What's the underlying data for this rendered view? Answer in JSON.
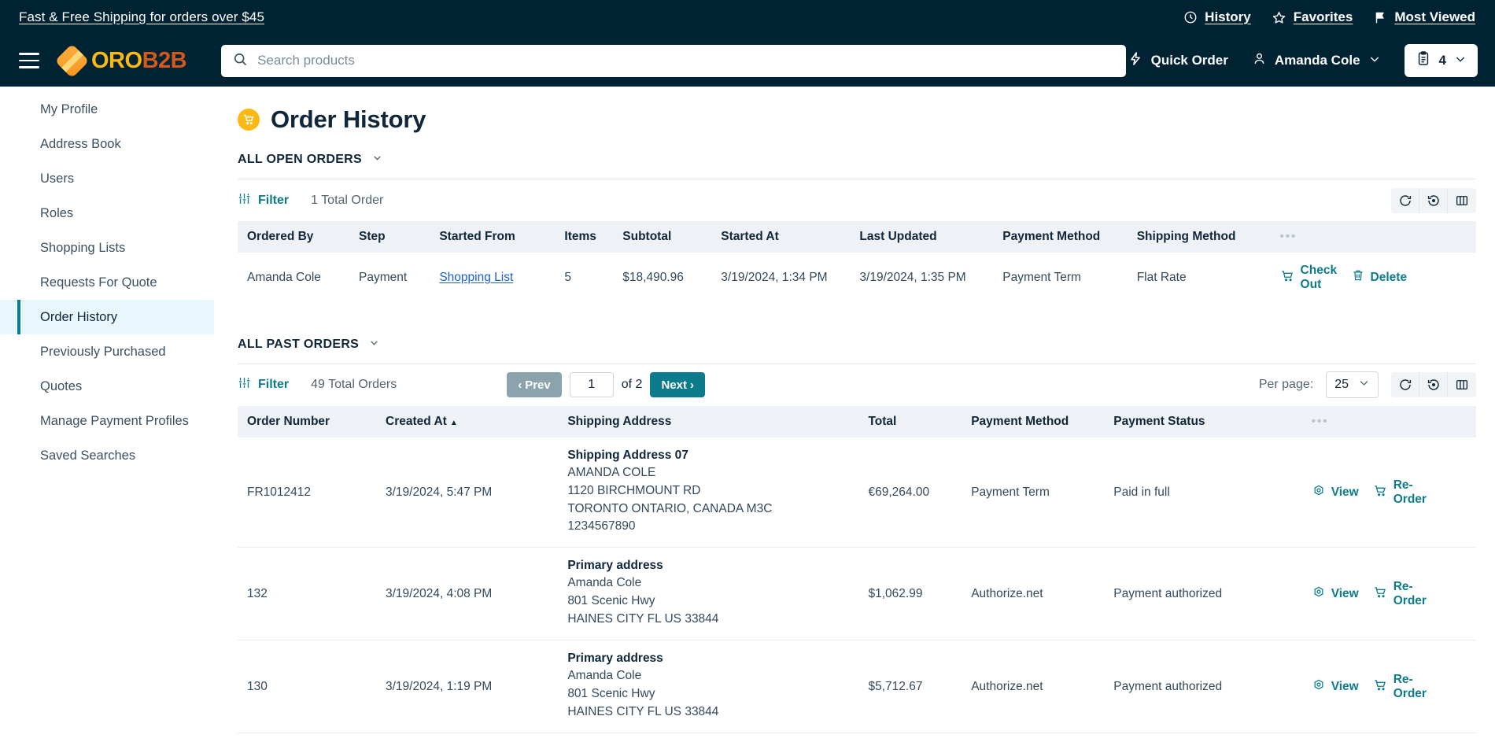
{
  "topbar": {
    "promo": "Fast & Free Shipping for orders over $45",
    "links": [
      {
        "label": "History",
        "icon": "clock-icon"
      },
      {
        "label": "Favorites",
        "icon": "star-icon"
      },
      {
        "label": "Most Viewed",
        "icon": "flag-icon"
      }
    ]
  },
  "header": {
    "logo_primary": "ORO",
    "logo_secondary": "B2B",
    "search_placeholder": "Search products",
    "search_value": "",
    "quick_order": "Quick Order",
    "account_name": "Amanda Cole",
    "cart_count": "4"
  },
  "sidebar": {
    "items": [
      {
        "label": "My Profile",
        "active": false
      },
      {
        "label": "Address Book",
        "active": false
      },
      {
        "label": "Users",
        "active": false
      },
      {
        "label": "Roles",
        "active": false
      },
      {
        "label": "Shopping Lists",
        "active": false
      },
      {
        "label": "Requests For Quote",
        "active": false
      },
      {
        "label": "Order History",
        "active": true
      },
      {
        "label": "Previously Purchased",
        "active": false
      },
      {
        "label": "Quotes",
        "active": false
      },
      {
        "label": "Manage Payment Profiles",
        "active": false
      },
      {
        "label": "Saved Searches",
        "active": false
      }
    ]
  },
  "page": {
    "title": "Order History"
  },
  "open_orders": {
    "section_label": "ALL OPEN ORDERS",
    "filter_label": "Filter",
    "total_text": "1 Total Order",
    "columns": [
      "Ordered By",
      "Step",
      "Started From",
      "Items",
      "Subtotal",
      "Started At",
      "Last Updated",
      "Payment Method",
      "Shipping Method"
    ],
    "rows": [
      {
        "ordered_by": "Amanda Cole",
        "step": "Payment",
        "started_from": "Shopping List",
        "items": "5",
        "subtotal": "$18,490.96",
        "started_at": "3/19/2024, 1:34 PM",
        "last_updated": "3/19/2024, 1:35 PM",
        "payment_method": "Payment Term",
        "shipping_method": "Flat Rate",
        "action_checkout": "Check Out",
        "action_delete": "Delete"
      }
    ]
  },
  "past_orders": {
    "section_label": "ALL PAST ORDERS",
    "filter_label": "Filter",
    "total_text": "49 Total Orders",
    "prev_label": "Prev",
    "next_label": "Next",
    "page_value": "1",
    "of_label": "of 2",
    "per_page_label": "Per page:",
    "per_page_value": "25",
    "columns": [
      "Order Number",
      "Created At",
      "Shipping Address",
      "Total",
      "Payment Method",
      "Payment Status"
    ],
    "sorted_column": "Created At",
    "sort_direction": "asc",
    "rows": [
      {
        "order_number": "FR1012412",
        "created_at": "3/19/2024, 5:47 PM",
        "address_title": "Shipping Address 07",
        "address_lines": [
          "AMANDA COLE",
          "1120 BIRCHMOUNT RD",
          "TORONTO ONTARIO, CANADA M3C",
          "1234567890"
        ],
        "total": "€69,264.00",
        "payment_method": "Payment Term",
        "payment_status": "Paid in full",
        "action_view": "View",
        "action_reorder": "Re-Order"
      },
      {
        "order_number": "132",
        "created_at": "3/19/2024, 4:08 PM",
        "address_title": "Primary address",
        "address_lines": [
          "Amanda Cole",
          "801 Scenic Hwy",
          "HAINES CITY FL US 33844"
        ],
        "total": "$1,062.99",
        "payment_method": "Authorize.net",
        "payment_status": "Payment authorized",
        "action_view": "View",
        "action_reorder": "Re-Order"
      },
      {
        "order_number": "130",
        "created_at": "3/19/2024, 1:19 PM",
        "address_title": "Primary address",
        "address_lines": [
          "Amanda Cole",
          "801 Scenic Hwy",
          "HAINES CITY FL US 33844"
        ],
        "total": "$5,712.67",
        "payment_method": "Authorize.net",
        "payment_status": "Payment authorized",
        "action_view": "View",
        "action_reorder": "Re-Order"
      }
    ]
  },
  "colors": {
    "header_bg": "#002333",
    "accent_teal": "#0c7c8c",
    "brand_yellow": "#fdb913",
    "brand_orange": "#d35a1e",
    "link_blue": "#1a5ed6"
  }
}
